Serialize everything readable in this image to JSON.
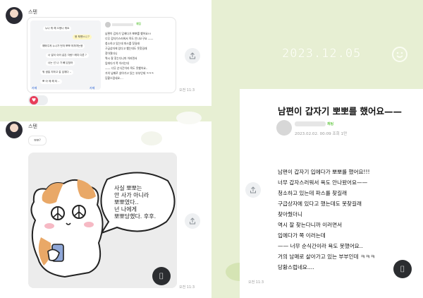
{
  "left_top": {
    "sender": "스텐",
    "card": {
      "chat": [
        "누나 뭐 해 으응나 뭐요",
        "응 뿌엔느니 ?",
        "해봐주게 누나가 먼저 뽀뽀 하자며는응",
        "너 말이 이러 같은 자랑? 해여 다른 ?",
        "너는 넌 나 가 빼 있었어",
        "뭐 생일 지하고 갈 입체다 ..",
        "뽀 아 께 해 되 .."
      ],
      "post_badge": "채팅",
      "post_lines": [
        "남편이 갑자기 입에다가 뽀뽀를 했어요!!!",
        "너무 갑자기스러워서 욕도 안나오구요 ——",
        "청소하고 있는데 파스를 찾길래",
        "구급상자에 있다고 했는데도 못찾길래",
        "찾아줬더니",
        "역시 잘 찾는다니까 이러면서",
        "입에다가 쪽 이러는데",
        "—— 너무 순식간이라 욕도 못했어요..",
        "거의 남매로 살아가고 있는 부부인데 ㅋㅋㅋ",
        "당황스럽네요...."
      ],
      "footer_left": "카페",
      "footer_right": "카페"
    },
    "heart_icon": "heart-icon",
    "time": "오전 11:3"
  },
  "left_bottom": {
    "sender": "스텐",
    "mini_bubble": "뽀뽀?",
    "speech": [
      "사실 뽀뽀는",
      "안 사가 아니라",
      "뽀뽀였다..",
      "넌 나에게",
      "뽀뽀당했다. 후후."
    ],
    "time": "오전 11:3"
  },
  "right": {
    "date": "2023.12.05",
    "title": "남편이 갑자기 뽀뽀를 했어요——",
    "badge": "채팅",
    "meta": "2023.02.02. 00:09  조회 1만",
    "body": [
      "남편이 갑자기 입에다가 뽀뽀를 했어요!!!",
      "너무 갑자스러워서 욕도 안나왔어요——",
      "청소하고 있는데 파스를 찾길래",
      "구급상자에 있다고 했는데도 못찾길래",
      "찾아줬더니",
      "역시 잘 찾는다니까 이러면서",
      "입에다가 쪽 이러는데",
      "—— 너무 순식간이라 욕도 못했어요..",
      "거의 남매로 살아가고 있는 부부인데 ㅋㅋㅋ",
      "당황스럽네요...."
    ],
    "time": "오전 11:3"
  },
  "icons": {
    "share": "share-icon",
    "scan": "scan-icon",
    "smile": "smile-icon"
  },
  "colors": {
    "green_bg": "#e7efd3",
    "heart": "#e83d5a",
    "badge_green": "#2db400"
  }
}
